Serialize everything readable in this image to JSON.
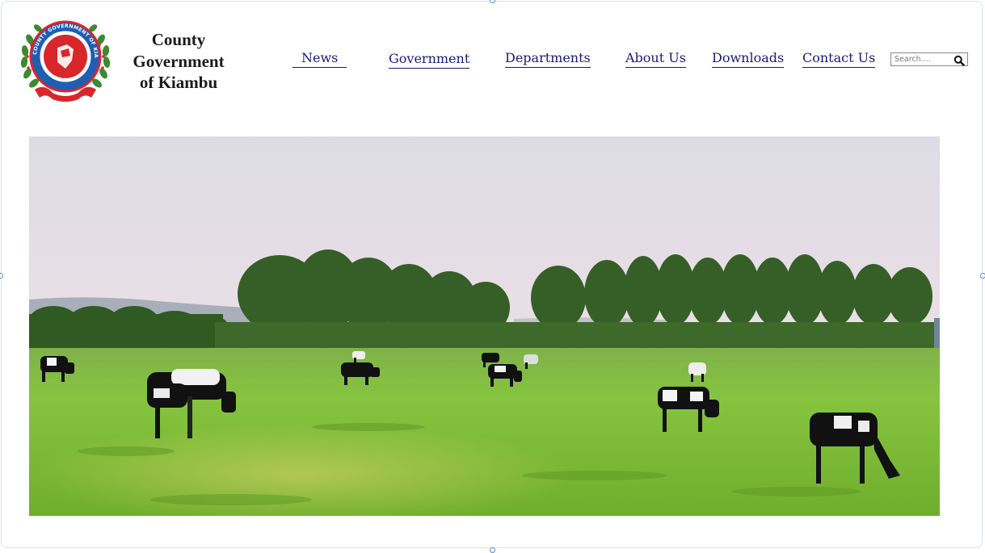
{
  "header": {
    "logo_text": "COUNTY GOVERNMENT OF KIAMBU",
    "logo_motto": "UGUTAGWO MWIUTI",
    "title_lines": [
      "County",
      "Government",
      "of Kiambu"
    ]
  },
  "nav": {
    "items": [
      {
        "label": "News"
      },
      {
        "label": "Government"
      },
      {
        "label": "Departments"
      },
      {
        "label": "About Us"
      },
      {
        "label": "Downloads"
      },
      {
        "label": "Contact Us"
      }
    ]
  },
  "search": {
    "placeholder": "Search....",
    "icon": "search-icon"
  },
  "hero": {
    "subject": "dairy cows grazing on green pasture",
    "icon": "hero-image"
  },
  "colors": {
    "nav_link": "#1a1a7a",
    "logo_blue": "#1e5fb4",
    "logo_red": "#d8262b",
    "logo_green": "#3a8a2e",
    "frame_border": "#cfe3f5"
  }
}
